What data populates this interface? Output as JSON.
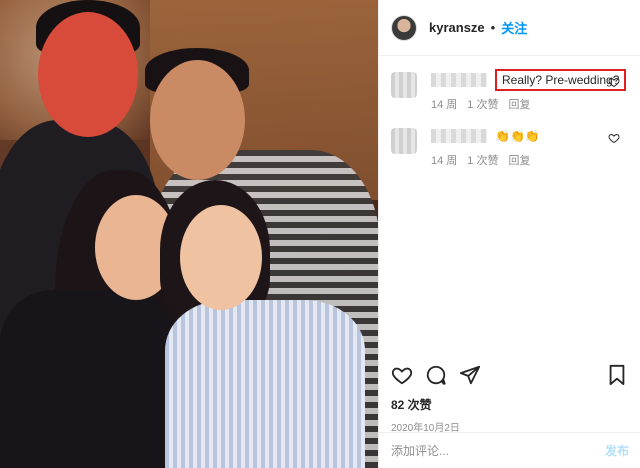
{
  "post": {
    "username": "kyransze",
    "separator": "•",
    "follow_label": "关注"
  },
  "comments": [
    {
      "text": "Really? Pre-wedding?",
      "time": "14 周",
      "likes": "1 次赞",
      "reply": "回复"
    },
    {
      "text": "👏👏👏",
      "time": "14 周",
      "likes": "1 次赞",
      "reply": "回复"
    }
  ],
  "actions": {
    "likes_count": "82 次赞",
    "date": "2020年10月2日"
  },
  "comment_box": {
    "placeholder": "添加评论...",
    "post_label": "发布"
  },
  "colors": {
    "follow_blue": "#0095f6",
    "highlight_red": "#e02020",
    "post_disabled": "#b2dffc"
  }
}
